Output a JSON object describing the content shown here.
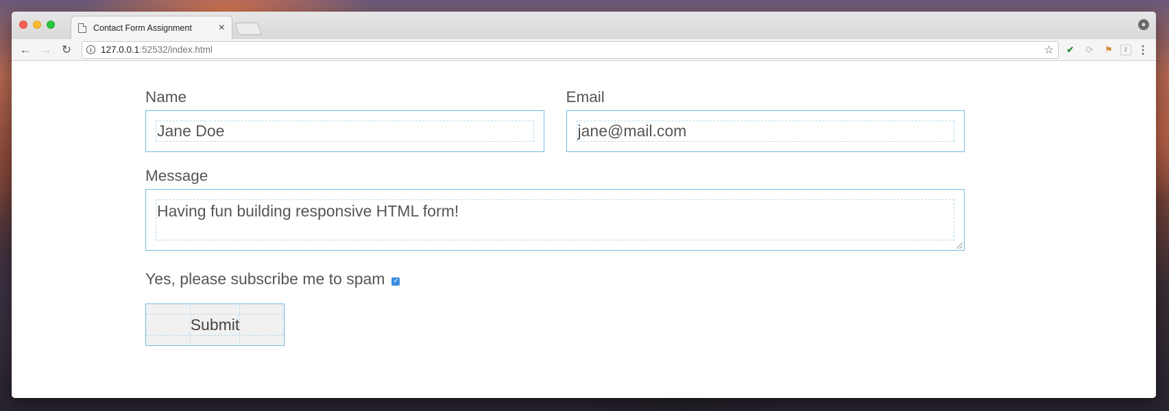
{
  "browser": {
    "tab_title": "Contact Form Assignment",
    "tab_close": "×",
    "url_host": "127.0.0.1",
    "url_rest": ":52532/index.html",
    "icons": [
      "back-arrow-icon",
      "forward-arrow-icon",
      "reload-icon",
      "info-icon",
      "star-icon",
      "profile-icon",
      "menu-icon"
    ]
  },
  "form": {
    "name_label": "Name",
    "name_value": "Jane Doe",
    "email_label": "Email",
    "email_value": "jane@mail.com",
    "message_label": "Message",
    "message_value": "Having fun building responsive HTML form!",
    "subscribe_label": "Yes, please subscribe me to spam",
    "subscribe_checked": true,
    "submit_label": "Submit"
  },
  "colors": {
    "field_border": "#74b9e4",
    "checkbox": "#3b8de0",
    "text": "#555555"
  }
}
